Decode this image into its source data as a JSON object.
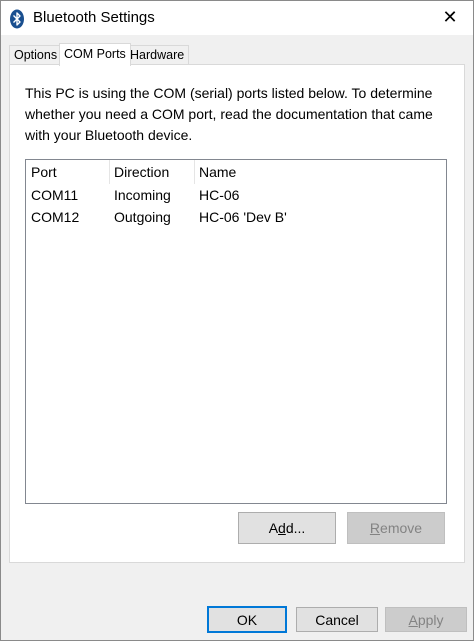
{
  "window": {
    "title": "Bluetooth Settings",
    "close_glyph": "✕"
  },
  "tabs": [
    {
      "label": "Options",
      "active": false
    },
    {
      "label": "COM Ports",
      "active": true
    },
    {
      "label": "Hardware",
      "active": false
    }
  ],
  "panel": {
    "description": "This PC is using the COM (serial) ports listed below. To determine whether you need a COM port, read the documentation that came with your Bluetooth device.",
    "columns": {
      "port": "Port",
      "direction": "Direction",
      "name": "Name"
    },
    "rows": [
      {
        "port": "COM11",
        "direction": "Incoming",
        "name": "HC-06"
      },
      {
        "port": "COM12",
        "direction": "Outgoing",
        "name": "HC-06 'Dev B'"
      }
    ],
    "add_button": {
      "label_pre": "A",
      "label_u": "d",
      "label_post": "d..."
    },
    "remove_button": {
      "label_u": "R",
      "label_post": "emove",
      "enabled": false
    }
  },
  "footer": {
    "ok_label": "OK",
    "cancel_label": "Cancel",
    "apply_label_u": "A",
    "apply_label_post": "pply",
    "apply_enabled": false
  },
  "colors": {
    "accent": "#0078d7",
    "bluetooth_icon": "#1a4f8f"
  },
  "icons": {
    "title": "bluetooth-icon",
    "close": "close-icon"
  }
}
